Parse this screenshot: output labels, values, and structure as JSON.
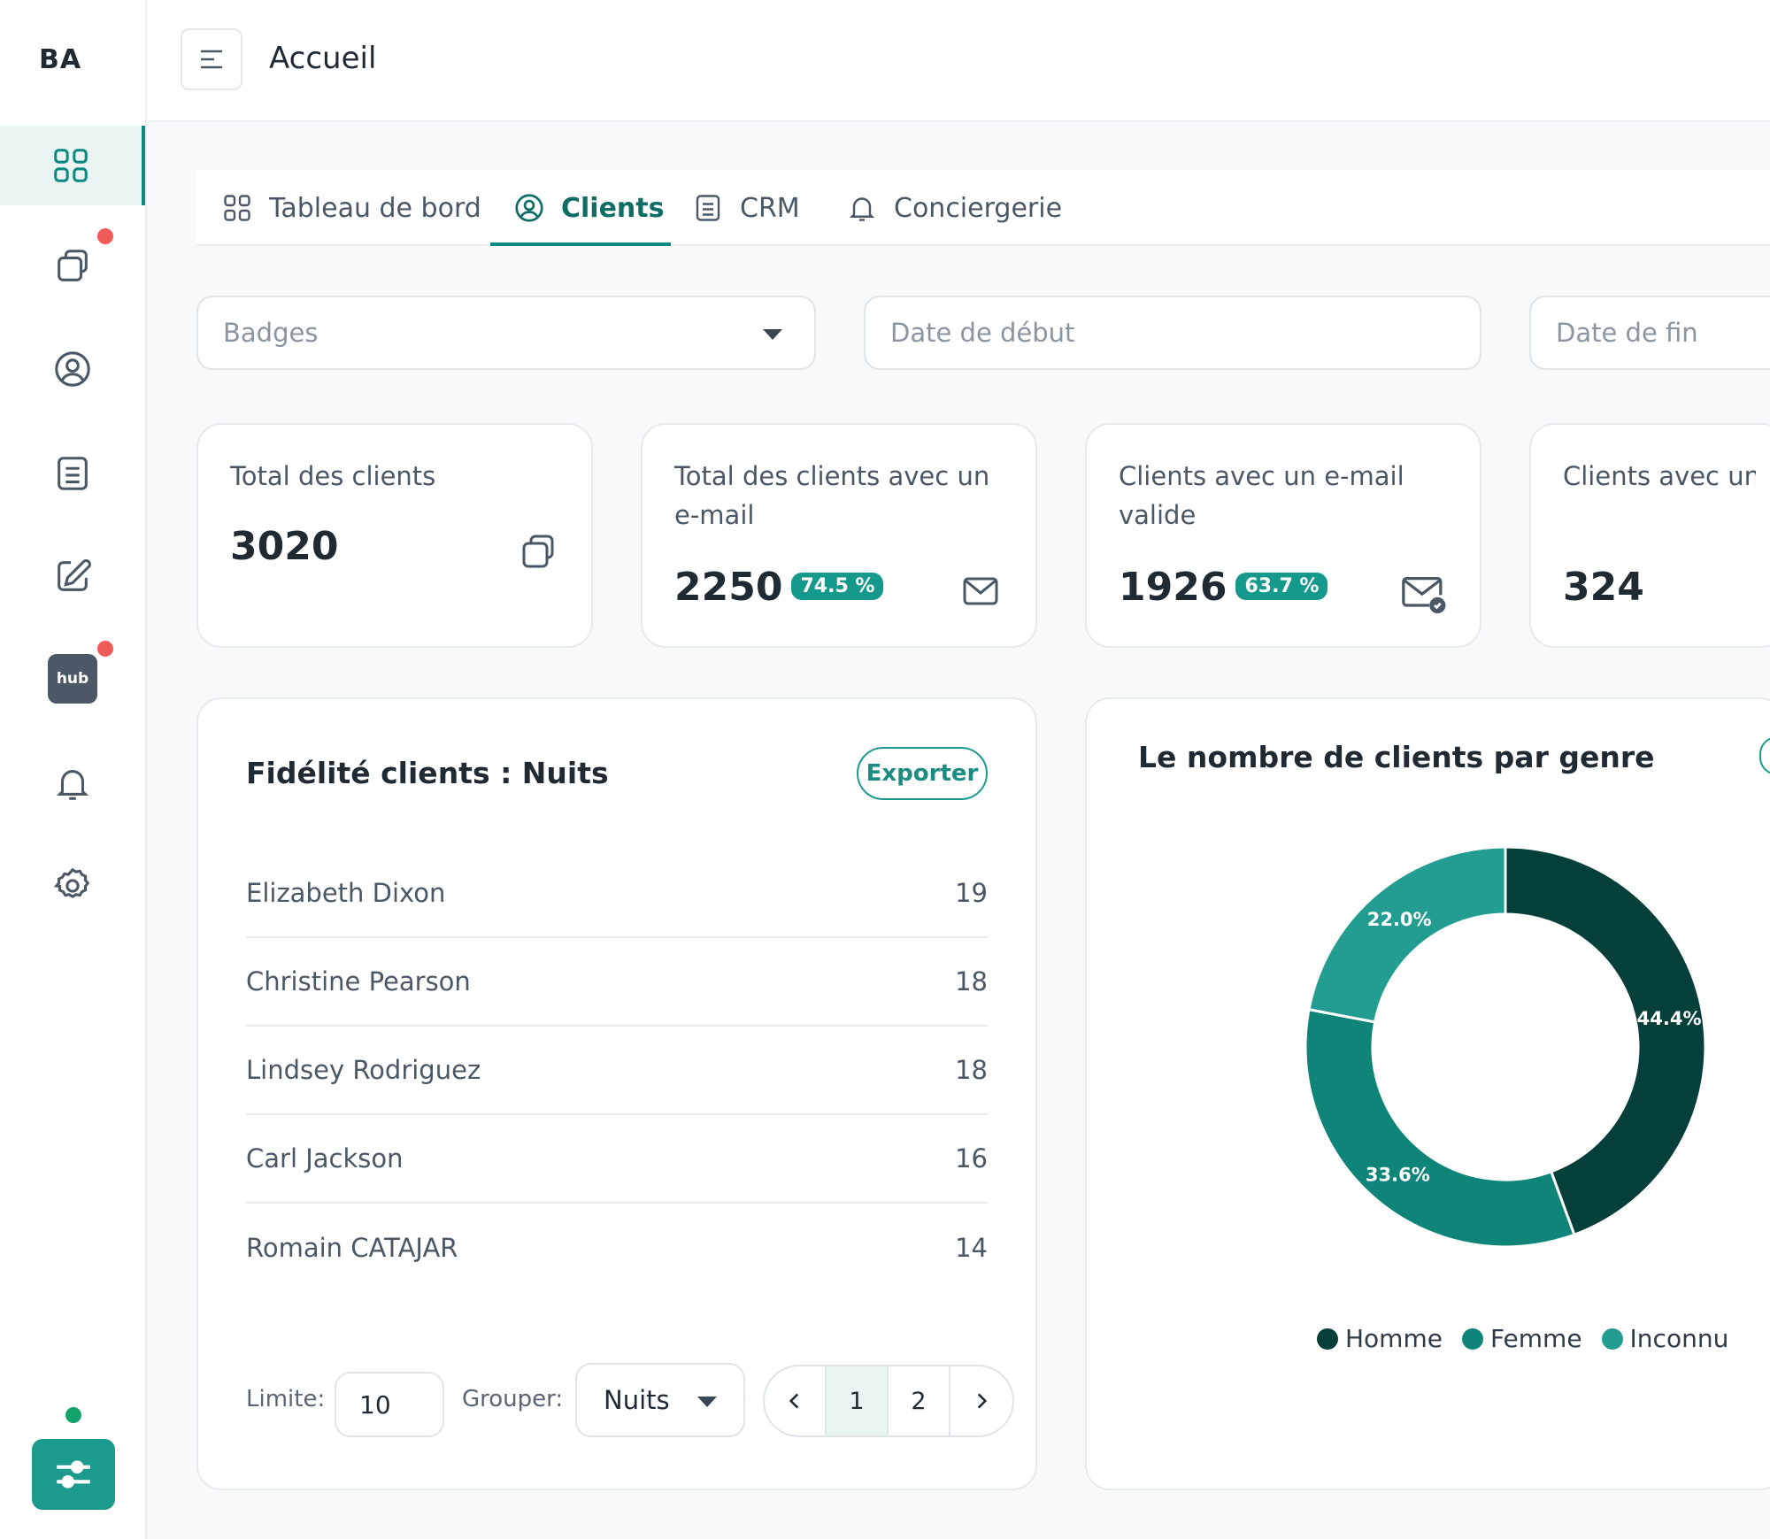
{
  "sidebar": {
    "brand": "BA",
    "hub_label": "hub",
    "items": [
      {
        "icon": "grid-icon",
        "active": true
      },
      {
        "icon": "copy-icon",
        "badge": true
      },
      {
        "icon": "user-circle-icon"
      },
      {
        "icon": "list-icon"
      },
      {
        "icon": "edit-icon"
      },
      {
        "icon": "hub-icon",
        "badge": true
      },
      {
        "icon": "bell-icon"
      },
      {
        "icon": "gear-icon"
      }
    ]
  },
  "header": {
    "title": "Accueil"
  },
  "tabs": [
    {
      "label": "Tableau de bord",
      "icon": "grid-icon"
    },
    {
      "label": "Clients",
      "icon": "user-circle-icon",
      "active": true
    },
    {
      "label": "CRM",
      "icon": "list-icon"
    },
    {
      "label": "Conciergerie",
      "icon": "bell-icon"
    }
  ],
  "filters": {
    "badges_placeholder": "Badges",
    "start_placeholder": "Date de début",
    "end_placeholder": "Date de fin"
  },
  "stats": [
    {
      "label": "Total des clients",
      "value": "3020",
      "pill": "",
      "icon": "copy-icon"
    },
    {
      "label": "Total des clients avec un e-mail",
      "value": "2250",
      "pill": "74.5 %",
      "icon": "mail-icon"
    },
    {
      "label": "Clients avec un e-mail valide",
      "value": "1926",
      "pill": "63.7 %",
      "icon": "mail-check-icon"
    },
    {
      "label": "Clients avec un e-mail OTA",
      "value": "324",
      "pill": ""
    }
  ],
  "loyalty": {
    "title": "Fidélité clients : Nuits",
    "export_label": "Exporter",
    "rows": [
      {
        "name": "Elizabeth Dixon",
        "value": "19"
      },
      {
        "name": "Christine Pearson",
        "value": "18"
      },
      {
        "name": "Lindsey Rodriguez",
        "value": "18"
      },
      {
        "name": "Carl Jackson",
        "value": "16"
      },
      {
        "name": "Romain CATAJAR",
        "value": "14"
      }
    ],
    "limit_label": "Limite:",
    "limit_value": "10",
    "group_label": "Grouper:",
    "group_value": "Nuits",
    "pages": [
      "1",
      "2"
    ],
    "current_page": "1"
  },
  "gender_chart": {
    "title": "Le nombre de clients par genre"
  },
  "chart_data": {
    "type": "pie",
    "title": "Le nombre de clients par genre",
    "categories": [
      "Homme",
      "Femme",
      "Inconnu"
    ],
    "values": [
      44.4,
      33.6,
      22.0
    ],
    "labels": [
      "44.4%",
      "33.6%",
      "22.0%"
    ],
    "colors": [
      "#053f3a",
      "#0f8479",
      "#239c92"
    ],
    "donut": true,
    "legend": "bottom"
  }
}
